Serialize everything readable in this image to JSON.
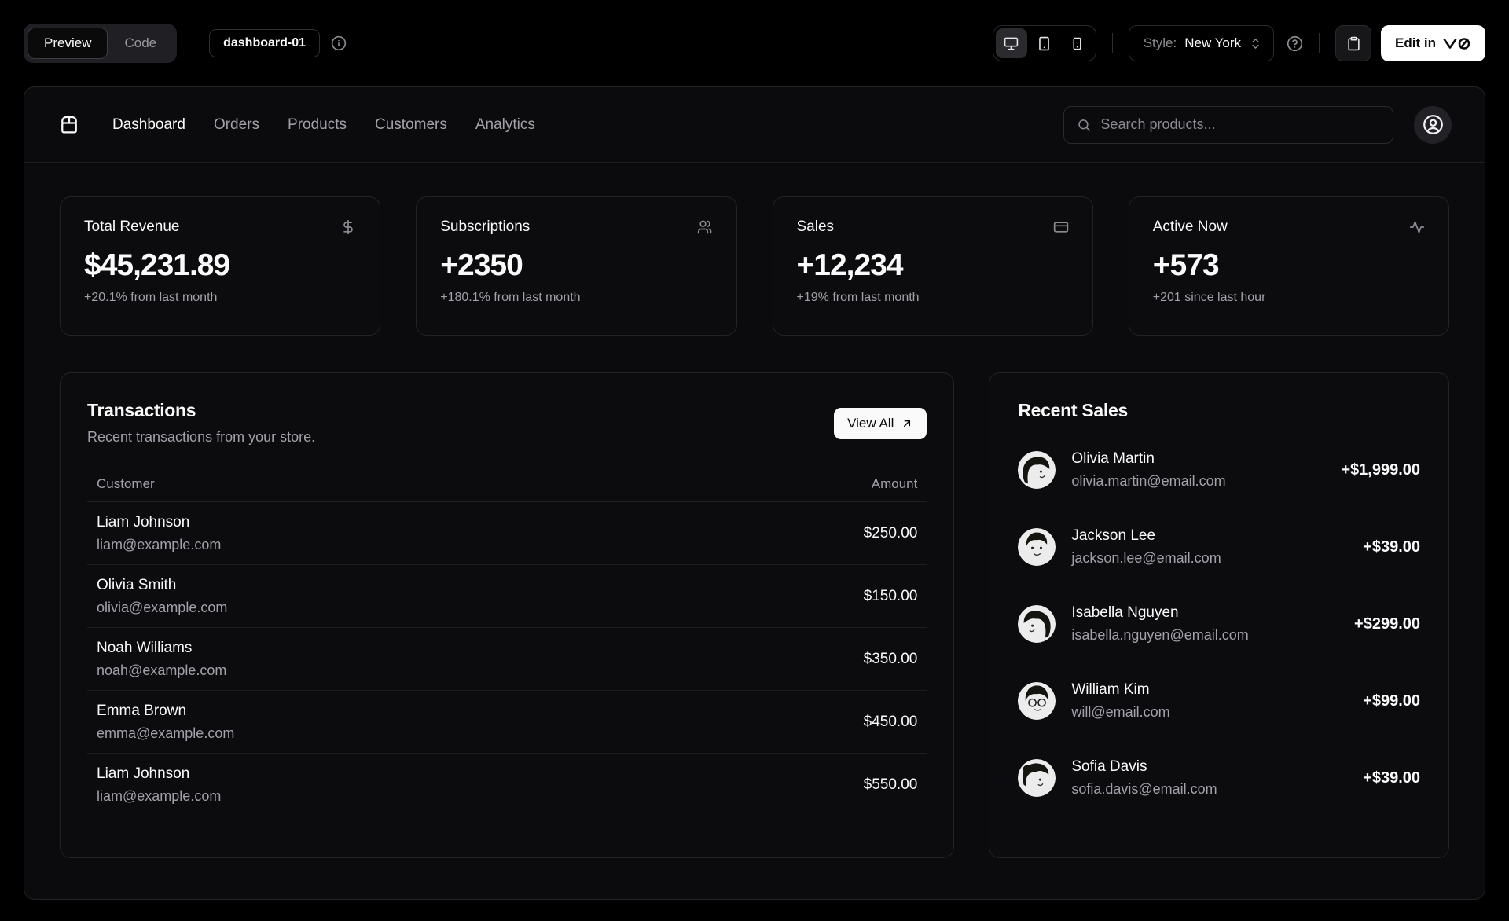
{
  "topbar": {
    "view_tabs": [
      {
        "label": "Preview"
      },
      {
        "label": "Code"
      }
    ],
    "block_badge": "dashboard-01",
    "style_label": "Style:",
    "style_value": "New York",
    "edit_in_label": "Edit in"
  },
  "nav": {
    "items": [
      "Dashboard",
      "Orders",
      "Products",
      "Customers",
      "Analytics"
    ],
    "search_placeholder": "Search products..."
  },
  "stats": [
    {
      "title": "Total Revenue",
      "icon": "dollar-sign-icon",
      "value": "$45,231.89",
      "change": "+20.1% from last month"
    },
    {
      "title": "Subscriptions",
      "icon": "users-icon",
      "value": "+2350",
      "change": "+180.1% from last month"
    },
    {
      "title": "Sales",
      "icon": "credit-card-icon",
      "value": "+12,234",
      "change": "+19% from last month"
    },
    {
      "title": "Active Now",
      "icon": "activity-icon",
      "value": "+573",
      "change": "+201 since last hour"
    }
  ],
  "transactions": {
    "title": "Transactions",
    "description": "Recent transactions from your store.",
    "view_all_label": "View All",
    "columns": [
      "Customer",
      "Amount"
    ],
    "rows": [
      {
        "name": "Liam Johnson",
        "email": "liam@example.com",
        "amount": "$250.00"
      },
      {
        "name": "Olivia Smith",
        "email": "olivia@example.com",
        "amount": "$150.00"
      },
      {
        "name": "Noah Williams",
        "email": "noah@example.com",
        "amount": "$350.00"
      },
      {
        "name": "Emma Brown",
        "email": "emma@example.com",
        "amount": "$450.00"
      },
      {
        "name": "Liam Johnson",
        "email": "liam@example.com",
        "amount": "$550.00"
      }
    ]
  },
  "recent_sales": {
    "title": "Recent Sales",
    "items": [
      {
        "name": "Olivia Martin",
        "email": "olivia.martin@email.com",
        "amount": "+$1,999.00"
      },
      {
        "name": "Jackson Lee",
        "email": "jackson.lee@email.com",
        "amount": "+$39.00"
      },
      {
        "name": "Isabella Nguyen",
        "email": "isabella.nguyen@email.com",
        "amount": "+$299.00"
      },
      {
        "name": "William Kim",
        "email": "will@email.com",
        "amount": "+$99.00"
      },
      {
        "name": "Sofia Davis",
        "email": "sofia.davis@email.com",
        "amount": "+$39.00"
      }
    ]
  },
  "colors": {
    "background": "#000000",
    "surface": "#0b0b0d",
    "card": "#0c0c0f",
    "border": "#232327",
    "text": "#fafafa",
    "muted": "#a1a1aa",
    "accent_button": "#ffffff"
  }
}
